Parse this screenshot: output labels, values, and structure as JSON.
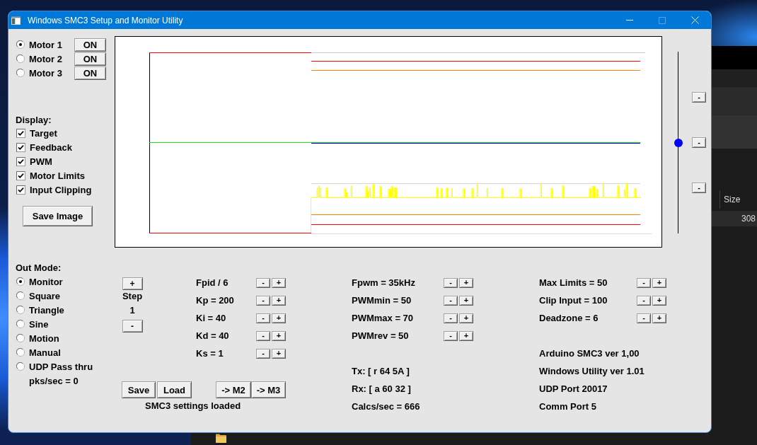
{
  "window": {
    "title": "Windows SMC3 Setup and Monitor Utility",
    "maximize_disabled": true
  },
  "motors": [
    {
      "label": "Motor 1",
      "selected": true,
      "button": "ON"
    },
    {
      "label": "Motor 2",
      "selected": false,
      "button": "ON"
    },
    {
      "label": "Motor 3",
      "selected": false,
      "button": "ON"
    }
  ],
  "display": {
    "label": "Display:",
    "options": [
      {
        "label": "Target",
        "checked": true
      },
      {
        "label": "Feedback",
        "checked": true
      },
      {
        "label": "PWM",
        "checked": true
      },
      {
        "label": "Motor Limits",
        "checked": true
      },
      {
        "label": "Input Clipping",
        "checked": true
      }
    ],
    "button": "Save Image"
  },
  "slider": {
    "level": 0.5,
    "buttons": [
      "-",
      "-",
      "-"
    ]
  },
  "out_mode": {
    "label": "Out Mode:",
    "options": [
      {
        "label": "Monitor",
        "selected": true
      },
      {
        "label": "Square",
        "selected": false
      },
      {
        "label": "Triangle",
        "selected": false
      },
      {
        "label": "Sine",
        "selected": false
      },
      {
        "label": "Motion",
        "selected": false
      },
      {
        "label": "Manual",
        "selected": false
      },
      {
        "label": "UDP Pass thru",
        "selected": false
      }
    ],
    "rate": "pks/sec = 0"
  },
  "step": {
    "plus": "+",
    "label": "Step",
    "value": "1",
    "minus": "-"
  },
  "pid_params": [
    {
      "label": "Fpid / 6",
      "minus": "-",
      "plus": "+"
    },
    {
      "label": "Kp = 200",
      "minus": "-",
      "plus": "+"
    },
    {
      "label": "Ki = 40",
      "minus": "-",
      "plus": "+"
    },
    {
      "label": "Kd = 40",
      "minus": "-",
      "plus": "+"
    },
    {
      "label": "Ks = 1",
      "minus": "-",
      "plus": "+"
    }
  ],
  "pwm_params": [
    {
      "label": "Fpwm = 35kHz",
      "minus": "-",
      "plus": "+"
    },
    {
      "label": "PWMmin = 50",
      "minus": "-",
      "plus": "+"
    },
    {
      "label": "PWMmax = 70",
      "minus": "-",
      "plus": "+"
    },
    {
      "label": "PWMrev = 50",
      "minus": "-",
      "plus": "+"
    }
  ],
  "limit_params": [
    {
      "label": "Max Limits = 50",
      "minus": "-",
      "plus": "+"
    },
    {
      "label": "Clip Input = 100",
      "minus": "-",
      "plus": "+"
    },
    {
      "label": "Deadzone = 6",
      "minus": "-",
      "plus": "+"
    }
  ],
  "file_buttons": [
    "Save",
    "Load"
  ],
  "copy_buttons": [
    "-> M2",
    "-> M3"
  ],
  "status_message": "SMC3 settings loaded",
  "comm_info": [
    "Tx: [ r 64 5A ]",
    "Rx: [ a 60 32 ]",
    "Calcs/sec = 666"
  ],
  "version_info": [
    "Arduino SMC3 ver 1,00",
    "Windows Utility ver 1.01",
    "UDP Port 20017",
    "Comm Port 5"
  ],
  "background_window": {
    "column_header": "Size",
    "cell": "308"
  }
}
